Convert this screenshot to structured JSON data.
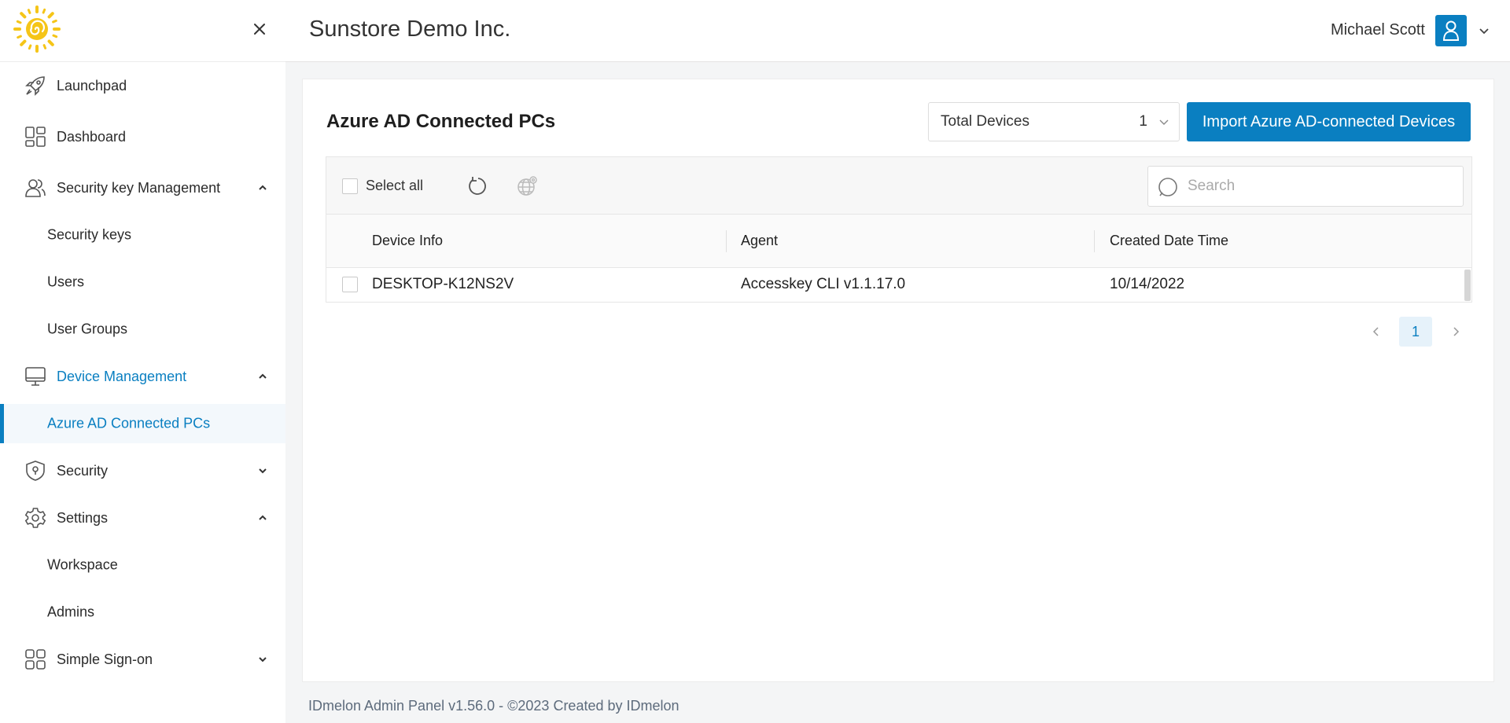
{
  "sidebar": {
    "logo": "sun-logo",
    "items": [
      {
        "label": "Launchpad",
        "icon": "rocket-icon"
      },
      {
        "label": "Dashboard",
        "icon": "dashboard-icon"
      },
      {
        "label": "Security key Management",
        "icon": "users-icon",
        "expanded": true
      },
      {
        "label": "Security keys"
      },
      {
        "label": "Users"
      },
      {
        "label": "User Groups"
      },
      {
        "label": "Device Management",
        "icon": "monitor-icon",
        "expanded": true
      },
      {
        "label": "Azure AD Connected PCs",
        "active": true
      },
      {
        "label": "Security",
        "icon": "shield-icon",
        "expanded": false
      },
      {
        "label": "Settings",
        "icon": "gear-icon",
        "expanded": true
      },
      {
        "label": "Workspace"
      },
      {
        "label": "Admins"
      },
      {
        "label": "Simple Sign-on",
        "icon": "grid-icon",
        "expanded": false
      }
    ]
  },
  "header": {
    "company": "Sunstore Demo Inc.",
    "user_name": "Michael Scott"
  },
  "main": {
    "title": "Azure AD Connected PCs",
    "total_label": "Total Devices",
    "total_value": "1",
    "import_button": "Import Azure AD-connected Devices",
    "select_all": "Select all",
    "search_placeholder": "Search",
    "columns": [
      "Device Info",
      "Agent",
      "Created Date Time"
    ],
    "rows": [
      {
        "device": "DESKTOP-K12NS2V",
        "agent": "Accesskey CLI v1.1.17.0",
        "created": "10/14/2022"
      }
    ],
    "current_page": "1"
  },
  "footer": "IDmelon Admin Panel v1.56.0 - ©2023 Created by IDmelon",
  "colors": {
    "accent": "#0a7fc1",
    "logo": "#f5c518"
  }
}
